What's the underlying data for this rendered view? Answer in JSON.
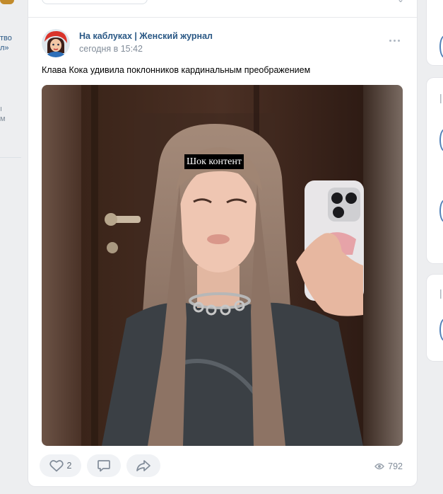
{
  "left_sidebar": {
    "fragment_1": "тво\nл»",
    "fragment_2": "ı\nм"
  },
  "post": {
    "author": "На каблуках | Женский журнал",
    "time": "сегодня в 15:42",
    "text": "Клава Кока удивила поклонников кардинальным преображением",
    "image_caption": "Шок контент",
    "likes": "2",
    "views": "792"
  },
  "icons": {
    "more": "more-horizontal-icon",
    "like": "heart-icon",
    "comment": "comment-icon",
    "share": "share-icon",
    "views": "eye-icon"
  },
  "colors": {
    "link": "#2a5885",
    "secondary_text": "#818c99",
    "page_bg": "#edeef0",
    "action_bg": "#f0f2f5"
  }
}
